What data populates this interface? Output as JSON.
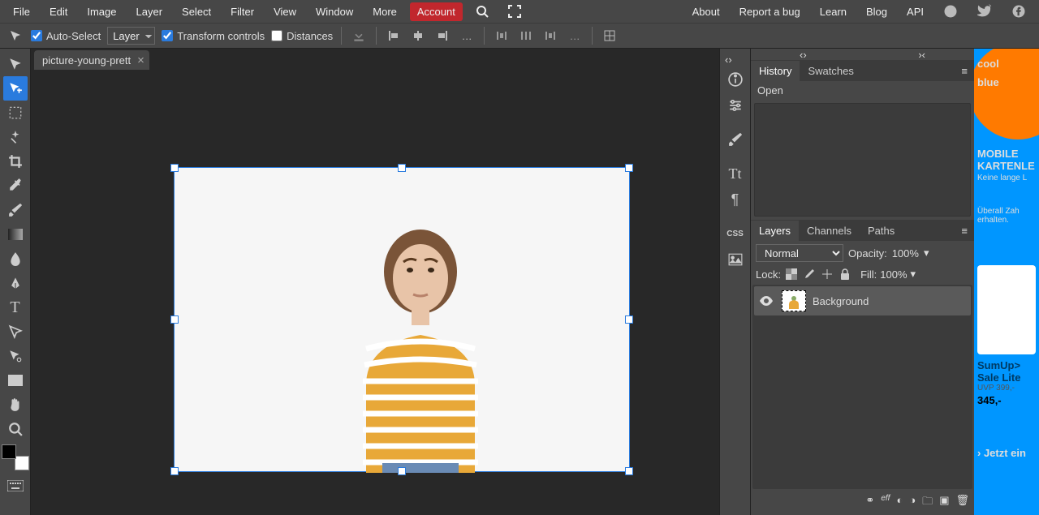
{
  "menu": {
    "items": [
      "File",
      "Edit",
      "Image",
      "Layer",
      "Select",
      "Filter",
      "View",
      "Window",
      "More"
    ],
    "account": "Account",
    "right": [
      "About",
      "Report a bug",
      "Learn",
      "Blog",
      "API"
    ]
  },
  "options": {
    "auto_select": "Auto-Select",
    "layer_select": "Layer",
    "transform": "Transform controls",
    "distances": "Distances",
    "auto_select_checked": true,
    "transform_checked": true,
    "distances_checked": false
  },
  "document": {
    "tab": "picture-young-prett"
  },
  "panels": {
    "history": {
      "tabs": [
        "History",
        "Swatches"
      ],
      "entry": "Open"
    },
    "layers": {
      "tabs": [
        "Layers",
        "Channels",
        "Paths"
      ],
      "blend_mode": "Normal",
      "opacity_label": "Opacity:",
      "opacity": "100%",
      "lock": "Lock:",
      "fill_label": "Fill:",
      "fill": "100%",
      "layer_name": "Background"
    }
  },
  "ad": {
    "logo1": "cool",
    "logo2": "blue",
    "h1": "MOBILE",
    "h2": "KARTENLE",
    "sub": "Keine lange L",
    "mid": "Überall Zah\nerhalten.",
    "product": "SumUp>\nSale Lite",
    "uvp": "UVP 399,-",
    "price": "345,-",
    "cta": "› Jetzt ein"
  }
}
